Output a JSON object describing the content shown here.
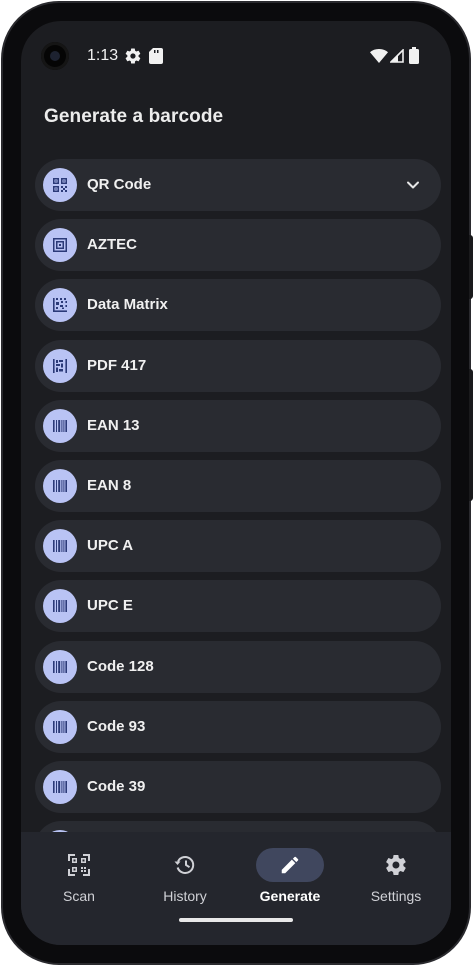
{
  "status_bar": {
    "time": "1:13",
    "icons": [
      "settings-gear-icon",
      "sd-card-icon",
      "wifi-icon",
      "signal-icon",
      "battery-icon"
    ]
  },
  "page": {
    "title": "Generate a barcode"
  },
  "barcode_types": [
    {
      "label": "QR Code",
      "icon": "qr-code-icon",
      "expandable": true
    },
    {
      "label": "AZTEC",
      "icon": "aztec-icon"
    },
    {
      "label": "Data Matrix",
      "icon": "data-matrix-icon"
    },
    {
      "label": "PDF 417",
      "icon": "pdf417-icon"
    },
    {
      "label": "EAN 13",
      "icon": "barcode-icon"
    },
    {
      "label": "EAN 8",
      "icon": "barcode-icon"
    },
    {
      "label": "UPC A",
      "icon": "barcode-icon"
    },
    {
      "label": "UPC E",
      "icon": "barcode-icon"
    },
    {
      "label": "Code 128",
      "icon": "barcode-icon"
    },
    {
      "label": "Code 93",
      "icon": "barcode-icon"
    },
    {
      "label": "Code 39",
      "icon": "barcode-icon"
    }
  ],
  "bottom_nav": {
    "items": [
      {
        "label": "Scan",
        "icon": "scan-icon"
      },
      {
        "label": "History",
        "icon": "history-icon"
      },
      {
        "label": "Generate",
        "icon": "pencil-icon",
        "active": true
      },
      {
        "label": "Settings",
        "icon": "gear-icon"
      }
    ]
  },
  "colors": {
    "background": "#1c1d21",
    "row": "#292b31",
    "badge": "#b9c3f4",
    "badge_icon": "#2b3a78",
    "nav_background": "#24262d",
    "nav_active_pill": "#40475e"
  }
}
